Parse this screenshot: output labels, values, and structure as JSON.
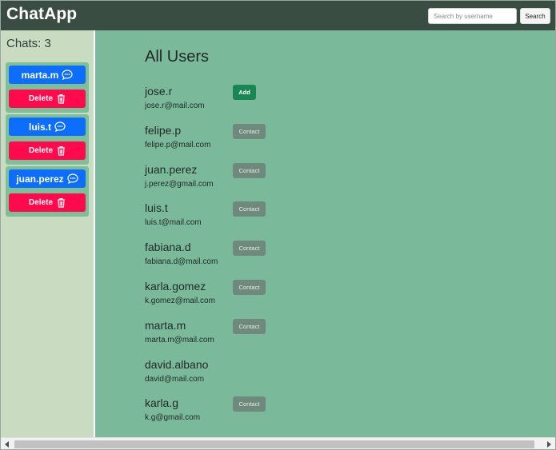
{
  "navbar": {
    "brand": "ChatApp",
    "search_placeholder": "Search by username",
    "search_label": "Search"
  },
  "sidebar": {
    "chats_count": "Chats: 3",
    "chats": [
      {
        "name": "marta.m",
        "delete_label": "Delete"
      },
      {
        "name": "luis.t",
        "delete_label": "Delete"
      },
      {
        "name": "juan.perez",
        "delete_label": "Delete"
      }
    ]
  },
  "main": {
    "title": "All Users",
    "users": [
      {
        "username": "jose.r",
        "email": "jose.r@mail.com",
        "action": "Add"
      },
      {
        "username": "felipe.p",
        "email": "felipe.p@mail.com",
        "action": "Contact"
      },
      {
        "username": "juan.perez",
        "email": "j.perez@gmail.com",
        "action": "Contact"
      },
      {
        "username": "luis.t",
        "email": "luis.t@mail.com",
        "action": "Contact"
      },
      {
        "username": "fabiana.d",
        "email": "fabiana.d@mail.com",
        "action": "Contact"
      },
      {
        "username": "karla.gomez",
        "email": "k.gomez@mail.com",
        "action": "Contact"
      },
      {
        "username": "marta.m",
        "email": "marta.m@mail.com",
        "action": "Contact"
      },
      {
        "username": "david.albano",
        "email": "david@mail.com",
        "action": ""
      },
      {
        "username": "karla.g",
        "email": "k.g@gmail.com",
        "action": "Contact"
      }
    ]
  },
  "colors": {
    "navbar_bg": "#3a4d43",
    "sidebar_bg": "#c9dcc1",
    "main_bg": "#7aba9b",
    "chat_button": "#0d6efd",
    "delete_button": "#ff0a4d",
    "add_button": "#198754",
    "contact_button": "#6f8a7c"
  },
  "icons": {
    "chat": "chat-bubble-icon",
    "delete": "trash-icon"
  }
}
